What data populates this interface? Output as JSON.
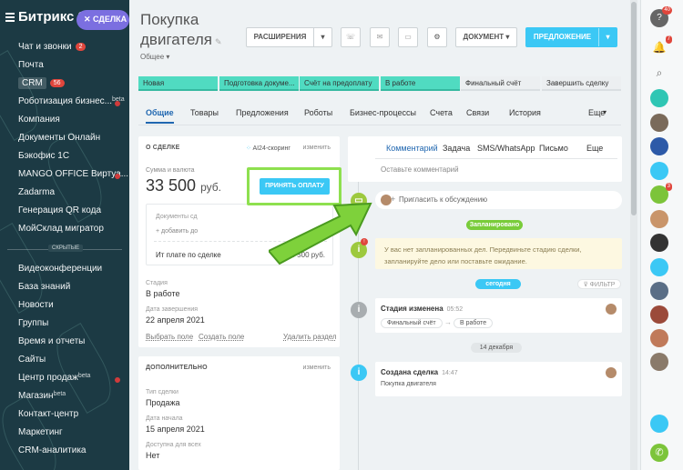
{
  "sidebar": {
    "brand": "Битрикс 2",
    "crm_pill": "СДЕЛКА",
    "items": [
      {
        "label": "Чат и звонки",
        "count": "2",
        "dot": false
      },
      {
        "label": "Почта",
        "dot": false
      },
      {
        "label": "CRM",
        "count": "56",
        "active": true
      },
      {
        "label": "Роботизация бизнес...",
        "sup": "beta",
        "dot": true
      },
      {
        "label": "Компания"
      },
      {
        "label": "Документы Онлайн"
      },
      {
        "label": "Бэкофис 1С"
      },
      {
        "label": "MANGO OFFICE Виртуа...",
        "dot": true
      },
      {
        "label": "Zadarma"
      },
      {
        "label": "Генерация QR кода"
      },
      {
        "label": "МойСклад мигратор"
      }
    ],
    "separator": "СКРЫТЫЕ",
    "items2": [
      {
        "label": "Видеоконференции"
      },
      {
        "label": "База знаний"
      },
      {
        "label": "Новости"
      },
      {
        "label": "Группы"
      },
      {
        "label": "Время и отчеты"
      },
      {
        "label": "Сайты"
      },
      {
        "label": "Центр продаж",
        "sup": "beta",
        "dot": true
      },
      {
        "label": "Магазин",
        "sup": "beta"
      },
      {
        "label": "Контакт-центр"
      },
      {
        "label": "Маркетинг"
      },
      {
        "label": "CRM-аналитика"
      }
    ]
  },
  "header": {
    "title": "Покупка двигателя",
    "category": "Общее",
    "btn_extension": "РАСШИРЕНИЯ",
    "btn_document": "ДОКУМЕНТ",
    "btn_offer": "ПРЕДЛОЖЕНИЕ"
  },
  "stages": [
    {
      "label": "Новая",
      "done": true
    },
    {
      "label": "Подготовка докуме...",
      "done": true
    },
    {
      "label": "Счёт на предоплату",
      "done": true
    },
    {
      "label": "В работе",
      "done": true
    },
    {
      "label": "Финальный счёт",
      "done": false
    },
    {
      "label": "Завершить сделку",
      "done": false
    }
  ],
  "tabs": [
    "Общие",
    "Товары",
    "Предложения",
    "Роботы",
    "Бизнес-процессы",
    "Счета",
    "Связи",
    "История",
    "Еще"
  ],
  "deal": {
    "head": "О СДЕЛКЕ",
    "ai_scoring": "AI24-скоринг",
    "edit": "изменить",
    "amount_label": "Сумма и валюта",
    "amount": "33 500",
    "currency": "руб.",
    "btn_accept": "ПРИНЯТЬ ОПЛАТУ",
    "docs_label": "Документы сд",
    "add_doc": "+ добавить до",
    "paid_label": "Ит            плате по сделке",
    "paid_value": "33 500 руб.",
    "stage_label": "Стадия",
    "stage_value": "В работе",
    "close_label": "Дата завершения",
    "close_value": "22 апреля 2021",
    "link_select": "Выбрать поле",
    "link_create": "Создать поле",
    "link_delete": "Удалить раздел"
  },
  "extra": {
    "head": "ДОПОЛНИТЕЛЬНО",
    "edit": "изменить",
    "type_label": "Тип сделки",
    "type_value": "Продажа",
    "start_label": "Дата начала",
    "start_value": "15 апреля 2021",
    "access_label": "Доступна для всех",
    "access_value": "Нет"
  },
  "timeline": {
    "ctabs": [
      "Комментарий",
      "Задача",
      "SMS/WhatsApp",
      "Письмо",
      "Еще"
    ],
    "comment_placeholder": "Оставьте комментарий",
    "invite": "Пригласить к обсуждению",
    "planned": "Запланировано",
    "planned_text": "У вас нет запланированных дел. Передвиньте стадию сделки, запланируйте дело или поставьте ожидание.",
    "today": "сегодня",
    "filter": "ФИЛЬТР",
    "stage_changed": "Стадия изменена",
    "stage_time": "05:52",
    "from_stage": "Финальный счёт",
    "to_stage": "В работе",
    "date_pill": "14 декабря",
    "created": "Создана сделка",
    "created_time": "14:47",
    "created_sub": "Покупка двигателя"
  },
  "right_panel": {
    "badge1": "40",
    "badge2": "7",
    "badge3": "3"
  },
  "colors": {
    "accent": "#3bc8f5",
    "stage_done": "#50dbc1",
    "highlight": "#8ee04f",
    "sidebar": "#1c3a44"
  }
}
